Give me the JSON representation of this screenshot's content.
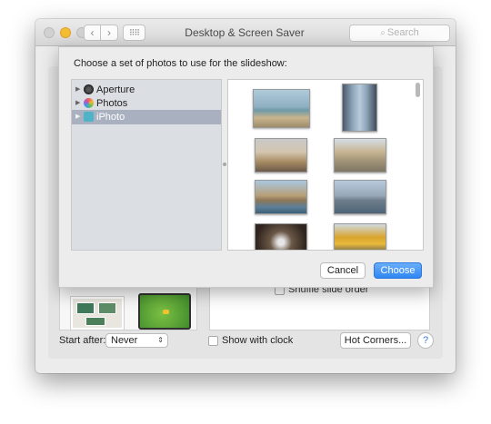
{
  "window": {
    "title": "Desktop & Screen Saver",
    "search_placeholder": "Search",
    "nav_back": "‹",
    "nav_forward": "›",
    "grid_glyph": "⠿⠿"
  },
  "sheet": {
    "prompt": "Choose a set of photos to use for the slideshow:",
    "sources": [
      {
        "label": "Aperture",
        "icon": "aperture-icon",
        "selected": false
      },
      {
        "label": "Photos",
        "icon": "photos-icon",
        "selected": false
      },
      {
        "label": "iPhoto",
        "icon": "iphoto-icon",
        "selected": true
      }
    ],
    "cancel_label": "Cancel",
    "choose_label": "Choose"
  },
  "options": {
    "shuffle_label": "Shuffle slide order",
    "start_after_label": "Start after:",
    "start_after_value": "Never",
    "show_clock_label": "Show with clock",
    "hot_corners_label": "Hot Corners...",
    "help_label": "?"
  },
  "colors": {
    "accent": "#2f86f3",
    "selection": "#a9b1c0",
    "minimize": "#f5bd32"
  }
}
